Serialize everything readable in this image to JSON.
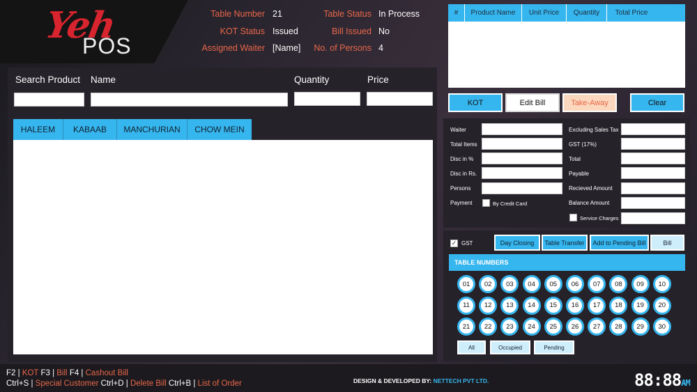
{
  "logo": {
    "script": "Yeh",
    "word": "POS"
  },
  "header": {
    "table_number_label": "Table Number",
    "table_number": "21",
    "kot_status_label": "KOT Status",
    "kot_status": "Issued",
    "assigned_waiter_label": "Assigned Waiter",
    "assigned_waiter": "[Name]",
    "table_status_label": "Table Status",
    "table_status": "In Process",
    "bill_issued_label": "Bill Issued",
    "bill_issued": "No",
    "persons_label": "No. of Persons",
    "persons": "4"
  },
  "search": {
    "search_label": "Search Product",
    "name_label": "Name",
    "quantity_label": "Quantity",
    "price_label": "Price"
  },
  "categories": [
    "HALEEM",
    "KABAAB",
    "MANCHURIAN",
    "CHOW MEIN"
  ],
  "order_table": {
    "columns": [
      "#",
      "Product Name",
      "Unit Price",
      "Quantity",
      "Total Price"
    ]
  },
  "actions": {
    "kot": "KOT",
    "edit_bill": "Edit Bill",
    "take_away": "Take-Away",
    "clear": "Clear"
  },
  "summary": {
    "waiter": "Waiter",
    "total_items": "Total Items",
    "disc_pct": "Disc in %",
    "disc_rs": "Disc in Rs.",
    "persons": "Persons",
    "payment": "Payment",
    "by_credit_card": "By Credit Card",
    "excl_tax": "Excluding Sales Tax",
    "gst": "GST (17%)",
    "total": "Total",
    "payable": "Payable",
    "received": "Recieved Amount",
    "balance": "Balance Amount",
    "service_charges": "Service Charges"
  },
  "controls": {
    "gst": "GST",
    "day_closing": "Day Closing",
    "table_transfer": "Table Transfer",
    "add_pending": "Add to Pending Bill",
    "bill": "Bill"
  },
  "tables": {
    "header": "TABLE NUMBERS",
    "numbers": [
      "01",
      "02",
      "03",
      "04",
      "05",
      "06",
      "07",
      "08",
      "09",
      "10",
      "11",
      "12",
      "13",
      "14",
      "15",
      "16",
      "17",
      "18",
      "19",
      "20",
      "21",
      "22",
      "23",
      "24",
      "25",
      "26",
      "27",
      "28",
      "29",
      "30"
    ],
    "filters": [
      "All",
      "Occupied",
      "Pending"
    ]
  },
  "footer": {
    "k_f2": "F2",
    "k_kot": "KOT",
    "k_f3": "F3",
    "k_bill": "Bill",
    "k_f4": "F4",
    "k_cashout": "Cashout Bill",
    "k_ctrls": "Ctrl+S",
    "k_special": "Special Customer",
    "k_ctrld": "Ctrl+D",
    "k_delete": "Delete Bill",
    "k_ctrlb": "Ctrl+B",
    "k_list": "List of Order",
    "credits_prefix": "DESIGN & DEVELOPED BY:",
    "credits_company": "NETTECH PVT LTD.",
    "clock_time": "88:88",
    "clock_ampm": "AM"
  },
  "colors": {
    "accent_blue": "#36b6ee",
    "accent_orange": "#e8674a",
    "brand_red": "#d8242e"
  }
}
